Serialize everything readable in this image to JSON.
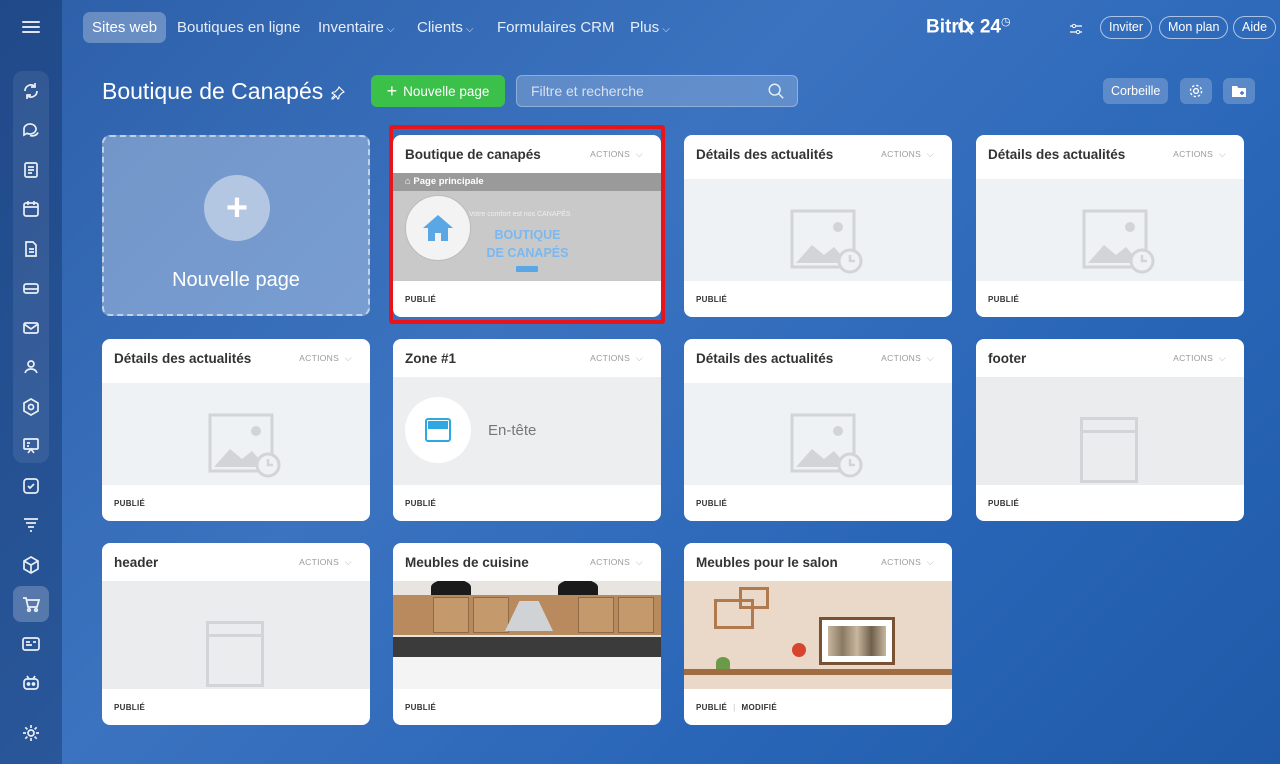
{
  "nav": {
    "items": [
      {
        "label": "Sites web",
        "active": true
      },
      {
        "label": "Boutiques en ligne"
      },
      {
        "label": "Inventaire",
        "chev": "⌵"
      },
      {
        "label": "Clients",
        "chev": "⌵"
      },
      {
        "label": "Formulaires CRM"
      },
      {
        "label": "Plus",
        "chev": "⌵"
      }
    ],
    "brand": "Bitrix 24",
    "invite": "Inviter",
    "plan": "Mon plan",
    "help": "Aide"
  },
  "header": {
    "title": "Boutique de Canapés",
    "new_page": "Nouvelle page",
    "search_placeholder": "Filtre et recherche",
    "trash": "Corbeille"
  },
  "new_card": {
    "label": "Nouvelle page"
  },
  "actions_label": "ACTIONS",
  "cards": [
    {
      "title": "Boutique de canapés",
      "status": "PUBLIÉ",
      "preview": "shop",
      "preview_text": {
        "bar": "Page principale",
        "tagline": "Votre comfort est nos CANAPÉS",
        "line1": "BOUTIQUE",
        "line2": "DE CANAPÉS"
      }
    },
    {
      "title": "Détails des actualités",
      "status": "PUBLIÉ",
      "preview": "image"
    },
    {
      "title": "Détails des actualités",
      "status": "PUBLIÉ",
      "preview": "image"
    },
    {
      "title": "Détails des actualités",
      "status": "PUBLIÉ",
      "preview": "image"
    },
    {
      "title": "Zone #1",
      "status": "PUBLIÉ",
      "preview": "zone",
      "zone_label": "En-tête"
    },
    {
      "title": "Détails des actualités",
      "status": "PUBLIÉ",
      "preview": "image"
    },
    {
      "title": "footer",
      "status": "PUBLIÉ",
      "preview": "frame"
    },
    {
      "title": "header",
      "status": "PUBLIÉ",
      "preview": "frame"
    },
    {
      "title": "Meubles de cuisine",
      "status": "PUBLIÉ",
      "preview": "kitchen"
    },
    {
      "title": "Meubles pour le salon",
      "status": "PUBLIÉ",
      "status2": "MODIFIÉ",
      "preview": "salon"
    }
  ],
  "colors": {
    "accent_green": "#3bc04a",
    "highlight_red": "#e8141b"
  }
}
